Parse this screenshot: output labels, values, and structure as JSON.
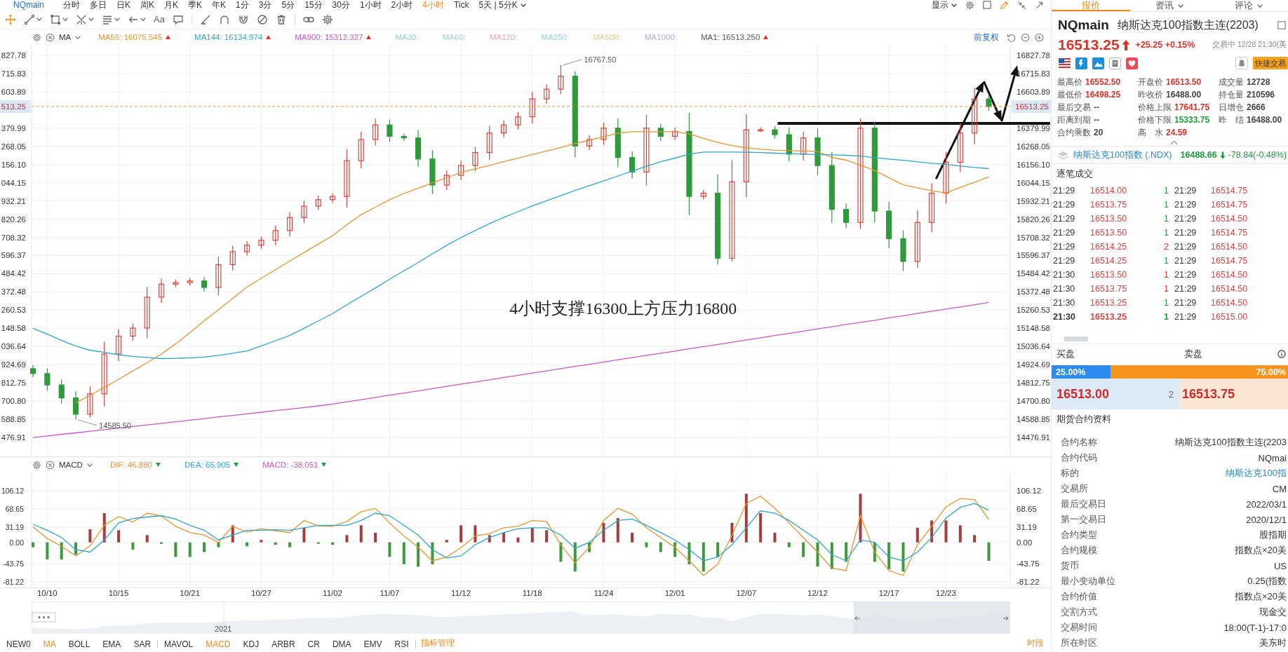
{
  "toolbar": {
    "symbol": "NQmain",
    "periods": [
      {
        "label": "分时",
        "selected": false
      },
      {
        "label": "多日",
        "selected": false
      },
      {
        "label": "日K",
        "selected": false
      },
      {
        "label": "周K",
        "selected": false
      },
      {
        "label": "月K",
        "selected": false
      },
      {
        "label": "季K",
        "selected": false
      },
      {
        "label": "年K",
        "selected": false
      },
      {
        "label": "1分",
        "selected": false
      },
      {
        "label": "3分",
        "selected": false
      },
      {
        "label": "5分",
        "selected": false
      },
      {
        "label": "15分",
        "selected": false
      },
      {
        "label": "30分",
        "selected": false
      },
      {
        "label": "1小时",
        "selected": false
      },
      {
        "label": "2小时",
        "selected": false
      },
      {
        "label": "4小时",
        "selected": true
      },
      {
        "label": "Tick",
        "selected": false
      }
    ],
    "range_menu": "5天 | 5分K",
    "display_menu": "显示"
  },
  "drawing_tools": [
    {
      "kind": "crosshair",
      "selected": true,
      "menu": false
    },
    {
      "kind": "line",
      "selected": false,
      "menu": true
    },
    {
      "kind": "rect",
      "selected": false,
      "menu": true
    },
    {
      "kind": "fork",
      "selected": false,
      "menu": true
    },
    {
      "kind": "lines",
      "selected": false,
      "menu": true
    },
    {
      "kind": "arrow",
      "selected": false,
      "menu": true
    },
    {
      "kind": "text",
      "label": "Aa",
      "selected": false,
      "menu": false
    },
    {
      "kind": "comment",
      "selected": false,
      "menu": false
    },
    {
      "kind": "separator"
    },
    {
      "kind": "angle",
      "selected": false,
      "menu": false
    },
    {
      "kind": "arch",
      "selected": false,
      "menu": false
    },
    {
      "kind": "magnet",
      "selected": false,
      "menu": false
    },
    {
      "kind": "hide",
      "selected": false,
      "menu": false
    },
    {
      "kind": "trash",
      "selected": false,
      "menu": false
    },
    {
      "kind": "separator"
    },
    {
      "kind": "link",
      "selected": false,
      "menu": false
    },
    {
      "kind": "gear",
      "selected": false,
      "menu": false
    }
  ],
  "price_legend": {
    "indicator": "MA",
    "items": [
      {
        "label": "MA55: 16075.545",
        "color": "#e3962f",
        "rising": true
      },
      {
        "label": "MA144: 16134.974",
        "color": "#2ea6cb",
        "rising": true
      },
      {
        "label": "MA900: 15312.327",
        "color": "#c657c9",
        "rising": true
      },
      {
        "label": "MA30:",
        "color": "#96cfe0"
      },
      {
        "label": "MA60:",
        "color": "#96d0d8"
      },
      {
        "label": "MA120:",
        "color": "#eaa9b9"
      },
      {
        "label": "MA250:",
        "color": "#98cfea"
      },
      {
        "label": "MA500:",
        "color": "#e5c98a"
      },
      {
        "label": "MA1000:",
        "color": "#b4a9dc"
      },
      {
        "label": "MA1: 16513.250",
        "color": "#555555",
        "rising": true
      }
    ],
    "adjust": "前复权"
  },
  "price_chart": {
    "left_axis": [
      "827.78",
      "715.83",
      "603.89",
      "379.99",
      "268.05",
      "156.10",
      "044.15",
      "932.21",
      "820.26",
      "708.32",
      "596.37",
      "484.42",
      "372.48",
      "260.53",
      "148.58",
      "036.64",
      "924.69",
      "812.75",
      "700.80",
      "588.85",
      "476.91"
    ],
    "left_price_tag": "513.25",
    "chart_data": {
      "type": "candlestick",
      "grid": true,
      "categories": [
        null,
        null,
        null,
        null,
        null,
        null,
        null,
        null,
        null,
        null,
        null,
        null,
        null,
        null,
        null,
        null,
        null,
        null,
        null,
        null,
        null,
        null,
        null,
        null,
        null,
        null,
        null,
        null,
        null,
        null,
        null,
        null,
        null,
        null,
        null,
        null,
        null,
        null,
        null,
        null,
        null,
        null,
        null,
        null,
        null,
        null,
        null,
        null,
        null,
        null,
        null,
        null,
        null,
        null,
        null,
        null,
        null,
        null,
        null,
        null,
        null,
        null,
        null,
        null,
        null,
        null,
        null,
        null
      ],
      "ylim": [
        14356,
        16892.5
      ],
      "yticks": [
        {
          "value": 16827.78,
          "label": "16827.78"
        },
        {
          "value": 16715.83,
          "label": "16715.83"
        },
        {
          "value": 16603.89,
          "label": "16603.89"
        },
        {
          "value": 16379.99,
          "label": "16379.99"
        },
        {
          "value": 16268.05,
          "label": "16268.05"
        },
        {
          "value": 16156.1,
          "label": "16156.10"
        },
        {
          "value": 16044.15,
          "label": "16044.15"
        },
        {
          "value": 15932.21,
          "label": "15932.21"
        },
        {
          "value": 15820.26,
          "label": "15820.26"
        },
        {
          "value": 15708.32,
          "label": "15708.32"
        },
        {
          "value": 15596.37,
          "label": "15596.37"
        },
        {
          "value": 15484.42,
          "label": "15484.42"
        },
        {
          "value": 15372.48,
          "label": "15372.48"
        },
        {
          "value": 15260.53,
          "label": "15260.53"
        },
        {
          "value": 15148.58,
          "label": "15148.58"
        },
        {
          "value": 15036.64,
          "label": "15036.64"
        },
        {
          "value": 14924.69,
          "label": "14924.69"
        },
        {
          "value": 14812.75,
          "label": "14812.75"
        },
        {
          "value": 14700.8,
          "label": "14700.80"
        },
        {
          "value": 14588.85,
          "label": "14588.85"
        },
        {
          "value": 14476.91,
          "label": "14476.91"
        }
      ],
      "ohlc": [
        [
          14900,
          14922,
          14848,
          14870
        ],
        [
          14870,
          14903,
          14767,
          14800
        ],
        [
          14800,
          14835,
          14685,
          14720
        ],
        [
          14720,
          14760,
          14585.5,
          14620
        ],
        [
          14620,
          14791,
          14600,
          14745
        ],
        [
          14745,
          15066,
          14669,
          14990
        ],
        [
          14990,
          15143,
          14947,
          15100
        ],
        [
          15100,
          15178,
          15072,
          15150
        ],
        [
          15150,
          15403,
          15087,
          15340
        ],
        [
          15340,
          15455,
          15305,
          15420
        ],
        [
          15420,
          15448,
          15402,
          15430
        ],
        [
          15430,
          15458,
          15412,
          15440
        ],
        [
          15440,
          15465,
          15375,
          15400
        ],
        [
          15400,
          15590,
          15350,
          15540
        ],
        [
          15540,
          15655,
          15505,
          15620
        ],
        [
          15620,
          15685,
          15595,
          15660
        ],
        [
          15660,
          15713,
          15637,
          15690
        ],
        [
          15690,
          15780,
          15660,
          15750
        ],
        [
          15750,
          15865,
          15715,
          15830
        ],
        [
          15830,
          15933,
          15797,
          15900
        ],
        [
          15900,
          15965,
          15875,
          15940
        ],
        [
          15940,
          15980,
          15920,
          15960
        ],
        [
          15960,
          16250,
          15890,
          16180
        ],
        [
          16180,
          16358,
          16132,
          16310
        ],
        [
          16310,
          16438,
          16272,
          16400
        ],
        [
          16400,
          16433,
          16297,
          16330
        ],
        [
          16330,
          16348,
          16302,
          16320
        ],
        [
          16320,
          16368,
          16142,
          16190
        ],
        [
          16190,
          16245,
          15975,
          16030
        ],
        [
          16030,
          16120,
          16000,
          16090
        ],
        [
          16090,
          16180,
          16060,
          16150
        ],
        [
          16150,
          16265,
          16115,
          16230
        ],
        [
          16230,
          16395,
          16185,
          16350
        ],
        [
          16350,
          16428,
          16322,
          16400
        ],
        [
          16400,
          16478,
          16372,
          16450
        ],
        [
          16450,
          16603,
          16407,
          16560
        ],
        [
          16560,
          16650,
          16530,
          16620
        ],
        [
          16620,
          16767.5,
          16590,
          16700
        ],
        [
          16700,
          16730,
          16200,
          16270
        ],
        [
          16270,
          16335,
          16245,
          16310
        ],
        [
          16310,
          16413,
          16277,
          16380
        ],
        [
          16380,
          16440,
          16140,
          16200
        ],
        [
          16200,
          16238,
          16072,
          16110
        ],
        [
          16110,
          16463,
          16027,
          16380
        ],
        [
          16380,
          16408,
          16302,
          16330
        ],
        [
          16330,
          16383,
          16307,
          16360
        ],
        [
          16360,
          16475,
          15845,
          15960
        ],
        [
          15960,
          16000,
          15940,
          15980
        ],
        [
          15980,
          16095,
          15540,
          15580
        ],
        [
          15580,
          16183,
          15560,
          16050
        ],
        [
          16050,
          16465,
          15955,
          16370
        ],
        [
          16370,
          16385,
          16355,
          16370
        ],
        [
          16370,
          16393,
          16317,
          16340
        ],
        [
          16340,
          16385,
          16175,
          16220
        ],
        [
          16220,
          16360,
          16180,
          16320
        ],
        [
          16320,
          16378,
          16092,
          16150
        ],
        [
          16150,
          16233,
          15797,
          15880
        ],
        [
          15880,
          15915,
          15765,
          15800
        ],
        [
          15800,
          16440,
          15760,
          16380
        ],
        [
          16380,
          16420,
          15800,
          15870
        ],
        [
          15870,
          15928,
          15642,
          15700
        ],
        [
          15700,
          15750,
          15500,
          15560
        ],
        [
          15560,
          15875,
          15520,
          15800
        ],
        [
          15800,
          16040,
          15740,
          15980
        ],
        [
          15980,
          16233,
          15917,
          16170
        ],
        [
          16170,
          16410,
          16110,
          16350
        ],
        [
          16350,
          16628,
          16282,
          16560
        ],
        [
          16560,
          16587,
          16486,
          16513
        ]
      ],
      "series": [
        {
          "type": "line",
          "color": "#e3962f",
          "values": [
            null,
            null,
            null,
            14690,
            14737,
            14785,
            14835,
            14886,
            14937,
            14990,
            15053,
            15122,
            15195,
            15263,
            15332,
            15403,
            15456,
            15509,
            15563,
            15615,
            15667,
            15718,
            15786,
            15847,
            15894,
            15940,
            15978,
            16010,
            16043,
            16075,
            16108,
            16130,
            16151,
            16174,
            16195,
            16218,
            16240,
            16261,
            16285,
            16306,
            16327,
            16349,
            16358,
            16358,
            16358,
            16358,
            16345,
            16317,
            16292,
            16273,
            16259,
            16250,
            16245,
            16242,
            16240,
            16236,
            16200,
            16183,
            16152,
            16120,
            16074,
            16031,
            16013,
            15995,
            15982,
            16015,
            16048,
            16080
          ]
        },
        {
          "type": "line",
          "color": "#2ea6cb",
          "values": [
            15148,
            15112,
            15074,
            15039,
            15014,
            15000,
            14986,
            14976,
            14969,
            14962,
            14964,
            14967,
            14971,
            14982,
            14995,
            15009,
            15040,
            15072,
            15105,
            15148,
            15194,
            15239,
            15293,
            15345,
            15396,
            15451,
            15502,
            15553,
            15607,
            15659,
            15707,
            15750,
            15793,
            15831,
            15866,
            15902,
            15933,
            15964,
            15997,
            16026,
            16055,
            16086,
            16115,
            16146,
            16174,
            16196,
            16220,
            16233,
            16233,
            16233,
            16232,
            16230,
            16226,
            16223,
            16220,
            16218,
            16216,
            16213,
            16208,
            16199,
            16190,
            16182,
            16173,
            16164,
            16156,
            16147,
            16138,
            16131
          ]
        },
        {
          "type": "line",
          "color": "#c657c9",
          "values": [
            14476,
            14486,
            14496,
            14505,
            14515,
            14525,
            14534,
            14544,
            14554,
            14564,
            14573,
            14583,
            14593,
            14603,
            14612,
            14622,
            14632,
            14642,
            14651,
            14661,
            14671,
            14682,
            14696,
            14709,
            14723,
            14737,
            14750,
            14763,
            14777,
            14791,
            14805,
            14818,
            14831,
            14846,
            14859,
            14873,
            14886,
            14900,
            14914,
            14927,
            14940,
            14955,
            14968,
            14982,
            14995,
            15008,
            15023,
            15036,
            15049,
            15063,
            15077,
            15090,
            15104,
            15117,
            15131,
            15145,
            15158,
            15172,
            15185,
            15198,
            15213,
            15226,
            15240,
            15254,
            15267,
            15280,
            15294,
            15308
          ]
        }
      ],
      "ref_lines": [
        {
          "axis": "y",
          "value": 16513.25,
          "label": "16513.25"
        }
      ],
      "annotations": [
        "16767.50",
        "14585.50",
        "4小时支撑16300上方压力16800"
      ]
    }
  },
  "macd_legend": {
    "indicator": "MACD",
    "items": [
      {
        "label": "DIF: 46.880",
        "color": "#e3962f",
        "rising": false
      },
      {
        "label": "DEA: 65.905",
        "color": "#2ea6cb",
        "rising": false
      },
      {
        "label": "MACD: -38.051",
        "color": "#c657c9",
        "rising": false
      }
    ]
  },
  "macd_chart": {
    "left_axis": [
      "106.12",
      "68.65",
      "31.19",
      "0.00",
      "-43.75",
      "-81.22"
    ],
    "chart_data": {
      "type": "bar",
      "stacked": true,
      "grid": true,
      "categories": [
        null,
        "10/10",
        null,
        null,
        null,
        null,
        "10/15",
        null,
        null,
        null,
        null,
        "10/21",
        null,
        null,
        null,
        null,
        "10/27",
        null,
        null,
        null,
        null,
        "11/02",
        null,
        null,
        null,
        "11/07",
        null,
        null,
        null,
        null,
        "11/12",
        null,
        null,
        null,
        null,
        "11/18",
        null,
        null,
        null,
        null,
        "11/24",
        null,
        null,
        null,
        null,
        "12/01",
        null,
        null,
        null,
        null,
        "12/07",
        null,
        null,
        null,
        null,
        "12/12",
        null,
        null,
        null,
        null,
        "12/17",
        null,
        null,
        null,
        "12/23",
        null,
        null,
        null
      ],
      "ylim": [
        -92.8,
        143.6
      ],
      "yticks": [
        {
          "value": 106.12,
          "label": "106.12"
        },
        {
          "value": 68.65,
          "label": "68.65"
        },
        {
          "value": 31.19,
          "label": "31.19"
        },
        {
          "value": 0,
          "label": "0.00"
        },
        {
          "value": -43.75,
          "label": "-43.75"
        },
        {
          "value": -81.22,
          "label": "-81.22"
        }
      ],
      "series": [
        {
          "color": "#a83c3c",
          "values": [
            null,
            null,
            null,
            null,
            27,
            60,
            25,
            null,
            15,
            null,
            null,
            null,
            null,
            null,
            35,
            null,
            5,
            null,
            null,
            30,
            null,
            null,
            15,
            35,
            20,
            null,
            null,
            null,
            null,
            5,
            35,
            35,
            15,
            20,
            10,
            30,
            25,
            null,
            null,
            null,
            40,
            50,
            20,
            null,
            null,
            null,
            null,
            null,
            null,
            40,
            100,
            60,
            20,
            null,
            null,
            null,
            null,
            null,
            100,
            null,
            null,
            null,
            30,
            45,
            45,
            35,
            15,
            null
          ]
        },
        {
          "color": "#3c9a3c",
          "values": [
            -10,
            -35,
            -35,
            -25,
            null,
            null,
            null,
            -15,
            null,
            -3,
            -30,
            -30,
            -20,
            -10,
            null,
            -8,
            null,
            -5,
            -10,
            null,
            -3,
            -5,
            null,
            null,
            null,
            -30,
            -45,
            -50,
            -45,
            null,
            null,
            null,
            null,
            null,
            null,
            null,
            null,
            -40,
            -60,
            -20,
            null,
            null,
            null,
            -10,
            -20,
            -30,
            -45,
            -60,
            -30,
            null,
            null,
            null,
            null,
            -10,
            -30,
            -50,
            -55,
            -40,
            null,
            -40,
            -55,
            -60,
            null,
            null,
            null,
            null,
            null,
            -38
          ]
        },
        {
          "type": "line",
          "color": "#e3962f",
          "values": [
            32,
            8,
            -8,
            -28,
            -7,
            35,
            53,
            42,
            60,
            54,
            33,
            20,
            15,
            0,
            33,
            21,
            28,
            24,
            20,
            45,
            34,
            33,
            43,
            63,
            70,
            40,
            13,
            -10,
            -38,
            -30,
            -11,
            13,
            18,
            30,
            33,
            45,
            43,
            -5,
            -42,
            -10,
            45,
            70,
            58,
            30,
            10,
            -10,
            -38,
            -68,
            -45,
            15,
            80,
            95,
            70,
            40,
            10,
            -20,
            -53,
            -58,
            55,
            -20,
            -58,
            -68,
            -5,
            33,
            73,
            90,
            88,
            47
          ]
        },
        {
          "type": "line",
          "color": "#2ea6cb",
          "values": [
            37,
            25,
            10,
            -15,
            -20,
            5,
            40,
            49,
            52,
            55,
            48,
            35,
            25,
            5,
            15,
            25,
            25,
            26,
            25,
            30,
            35,
            35,
            35,
            45,
            60,
            55,
            35,
            15,
            -15,
            -32,
            -28,
            -5,
            10,
            20,
            28,
            30,
            30,
            15,
            -12,
            0,
            25,
            45,
            48,
            35,
            20,
            5,
            -15,
            -38,
            -30,
            -5,
            30,
            65,
            60,
            45,
            25,
            5,
            -25,
            -38,
            5,
            0,
            -30,
            -38,
            -20,
            10,
            50,
            72,
            80,
            66
          ]
        }
      ]
    }
  },
  "navigator": {
    "label": "2021",
    "level": 0.16
  },
  "indicator_bar": {
    "main": [
      {
        "label": "NEW0",
        "selected": false
      },
      {
        "label": "MA",
        "selected": true
      },
      {
        "label": "BOLL",
        "selected": false
      },
      {
        "label": "EMA",
        "selected": false
      },
      {
        "label": "SAR",
        "selected": false
      }
    ],
    "sub": [
      {
        "label": "MAVOL",
        "selected": false
      },
      {
        "label": "MACD",
        "selected": true
      },
      {
        "label": "KDJ",
        "selected": false
      },
      {
        "label": "ARBR",
        "selected": false
      },
      {
        "label": "CR",
        "selected": false
      },
      {
        "label": "DMA",
        "selected": false
      },
      {
        "label": "EMV",
        "selected": false
      },
      {
        "label": "RSI",
        "selected": false
      }
    ],
    "manage": "指标管理",
    "session": "时段"
  },
  "side_tabs": [
    {
      "label": "报价",
      "selected": true,
      "menu": false
    },
    {
      "label": "资讯",
      "selected": false,
      "menu": true
    },
    {
      "label": "评论",
      "selected": false,
      "menu": true
    }
  ],
  "quote": {
    "symbol": "NQmain",
    "name": "纳斯达克100指数主连(2203)",
    "price": "16513.25",
    "rising": true,
    "change": "+25.25 +0.15%",
    "status": "交易中 12/28 21:30(美",
    "trade_button": "快捷交易"
  },
  "stats": [
    {
      "label": "最高价",
      "figure": "16552.50",
      "color": "#e0302a"
    },
    {
      "label": "开盘价",
      "figure": "16513.50",
      "color": "#e0302a"
    },
    {
      "label": "成交量",
      "figure": "12728",
      "color": "#444444"
    },
    {
      "label": "最低价",
      "figure": "16498.25",
      "color": "#e0302a"
    },
    {
      "label": "昨收价",
      "figure": "16488.00",
      "color": "#444444"
    },
    {
      "label": "持仓量",
      "figure": "210596",
      "color": "#444444"
    },
    {
      "label": "最后交易",
      "figure": "--",
      "color": "#444444"
    },
    {
      "label": "价格上限",
      "figure": "17641.75",
      "color": "#e0302a"
    },
    {
      "label": "日增仓",
      "figure": "2666",
      "color": "#444444"
    },
    {
      "label": "距离到期",
      "figure": "--",
      "color": "#444444"
    },
    {
      "label": "价格下限",
      "figure": "15333.75",
      "color": "#1f9d3a"
    },
    {
      "label": "昨　结",
      "figure": "16488.00",
      "color": "#444444"
    },
    {
      "label": "合约乘数",
      "figure": "20",
      "color": "#444444"
    },
    {
      "label": "高　水",
      "figure": "24.59",
      "color": "#e0302a"
    }
  ],
  "index_quote": {
    "name": "纳斯达克100指数 (.NDX)",
    "price": "16488.66",
    "rising": false,
    "change": "-78.84(-0.48%)"
  },
  "trades": {
    "title": "逐笔成交",
    "rows": [
      {
        "time": "21:29",
        "price": "16514.00",
        "qty": "1",
        "color": "#1f9d3a",
        "time_2": "21:29",
        "price_2": "16514.75",
        "latest": false
      },
      {
        "time": "21:29",
        "price": "16513.75",
        "qty": "1",
        "color": "#1f9d3a",
        "time_2": "21:29",
        "price_2": "16514.75",
        "latest": false
      },
      {
        "time": "21:29",
        "price": "16513.50",
        "qty": "1",
        "color": "#1f9d3a",
        "time_2": "21:29",
        "price_2": "16514.50",
        "latest": false
      },
      {
        "time": "21:29",
        "price": "16513.50",
        "qty": "1",
        "color": "#1f9d3a",
        "time_2": "21:29",
        "price_2": "16514.75",
        "latest": false
      },
      {
        "time": "21:29",
        "price": "16514.25",
        "qty": "2",
        "color": "#e0302a",
        "time_2": "21:29",
        "price_2": "16514.50",
        "latest": false
      },
      {
        "time": "21:29",
        "price": "16514.25",
        "qty": "1",
        "color": "#1f9d3a",
        "time_2": "21:29",
        "price_2": "16514.75",
        "latest": false
      },
      {
        "time": "21:30",
        "price": "16513.50",
        "qty": "1",
        "color": "#e0302a",
        "time_2": "21:29",
        "price_2": "16514.50",
        "latest": false
      },
      {
        "time": "21:30",
        "price": "16513.75",
        "qty": "1",
        "color": "#e0302a",
        "time_2": "21:29",
        "price_2": "16514.50",
        "latest": false
      },
      {
        "time": "21:30",
        "price": "16513.25",
        "qty": "1",
        "color": "#1f9d3a",
        "time_2": "21:29",
        "price_2": "16514.50",
        "latest": false
      },
      {
        "time": "21:30",
        "price": "16513.25",
        "qty": "1",
        "color": "#1f9d3a",
        "time_2": "21:29",
        "price_2": "16515.00",
        "latest": true
      }
    ]
  },
  "order_book": {
    "bid_label": "买盘",
    "ask_label": "卖盘",
    "share": {
      "level": 0.25,
      "bid_text": "25.00%",
      "ask_text": "75.00%"
    },
    "bid_price": "16513.00",
    "bid_size": "2",
    "ask_price": "16513.75"
  },
  "contract_info": {
    "title": "期货合约资料",
    "rows": [
      {
        "label": "合约名称",
        "value": "纳斯达克100指数主连(2203",
        "kind": "text"
      },
      {
        "label": "合约代码",
        "value": "NQmai",
        "kind": "text"
      },
      {
        "label": "标的",
        "value": "纳斯达克100指",
        "kind": "link"
      },
      {
        "label": "交易所",
        "value": "CM",
        "kind": "text"
      },
      {
        "label": "最后交易日",
        "value": "2022/03/1",
        "kind": "text"
      },
      {
        "label": "第一交易日",
        "value": "2020/12/1",
        "kind": "text"
      },
      {
        "label": "合约类型",
        "value": "股指期",
        "kind": "text"
      },
      {
        "label": "合约规模",
        "value": "指数点×20美",
        "kind": "text"
      },
      {
        "label": "货币",
        "value": "US",
        "kind": "text"
      },
      {
        "label": "最小变动单位",
        "value": "0.25(指数",
        "kind": "text"
      },
      {
        "label": "合约价值",
        "value": "指数点×20美",
        "kind": "text"
      },
      {
        "label": "交割方式",
        "value": "现金交",
        "kind": "text"
      },
      {
        "label": "交易时间",
        "value": "18:00(T-1)-17:0",
        "kind": "text"
      },
      {
        "label": "所在时区",
        "value": "美东时",
        "kind": "text"
      }
    ]
  }
}
